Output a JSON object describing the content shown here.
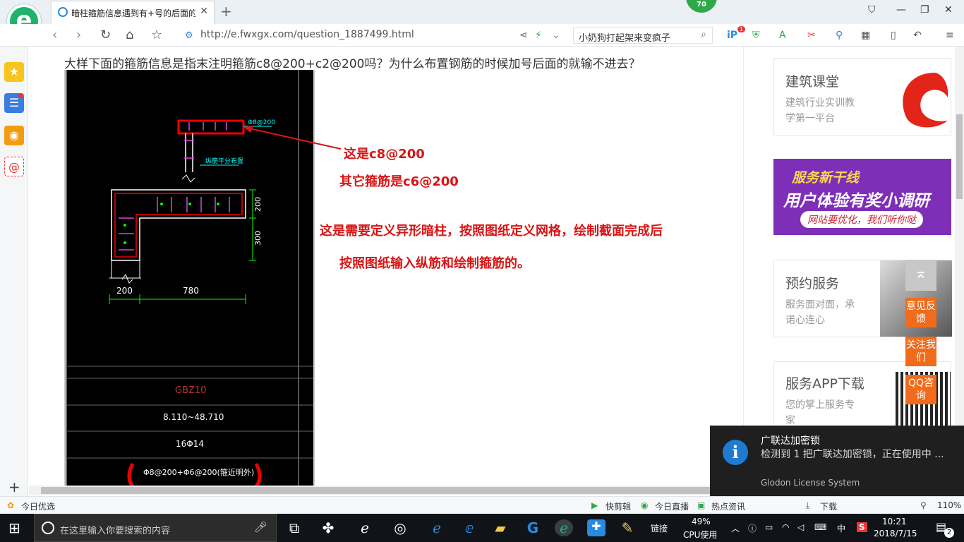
{
  "browser": {
    "tab_title": "暗柱箍筋信息遇到有+号的后面的",
    "badge": "70",
    "url": "http://e.fwxgx.com/question_1887499.html",
    "search_text": "小奶狗打起架来变疯子",
    "badge_count": "1"
  },
  "question": {
    "text": "大样下面的箍筋信息是指末注明箍筋c8@200+c2@200吗？为什么布置钢筋的时候加号后面的就输不进去？"
  },
  "drawing": {
    "top_label": "Φ8@200",
    "mid_label": "纵筋平分布置",
    "dim_200v": "200",
    "dim_300v": "300",
    "dim_200h": "200",
    "dim_780h": "780",
    "row1": "GBZ10",
    "row2": "8.110~48.710",
    "row3": "16Φ14",
    "row4": "Φ8@200+Φ6@200(箍近明外)"
  },
  "answer": {
    "line1": "这是c8@200",
    "line2": "其它箍筋是c6@200",
    "line3": "这是需要定义异形暗柱，按照图纸定义网格，绘制截面完成后",
    "line4": "按照图纸输入纵筋和绘制箍筋的。"
  },
  "sidebar_right": {
    "card1_title": "建筑课堂",
    "card1_desc1": "建筑行业实训教",
    "card1_desc2": "学第一平台",
    "banner_line1": "服务新干线",
    "banner_line2": "用户体验有奖小调研",
    "banner_line3": "网站要优化，我们听你哒",
    "card2_title": "预约服务",
    "card2_desc1": "服务面对面，承",
    "card2_desc2": "诺心连心",
    "card3_title": "服务APP下载",
    "card3_desc1": "您的掌上服务专",
    "card3_desc2": "家"
  },
  "float_buttons": {
    "feedback": "意见反馈",
    "follow": "关注我们",
    "qq": "QQ咨询"
  },
  "statusbar": {
    "left": "今日优选",
    "kuaijianji": "快剪辑",
    "live": "今日直播",
    "news": "热点资讯",
    "download": "下载",
    "zoom": "110%"
  },
  "toast": {
    "title": "广联达加密锁",
    "body": "检测到 1 把广联达加密锁，正在使用中 ...",
    "footer": "Glodon License System"
  },
  "taskbar": {
    "search_placeholder": "在这里输入你要搜索的内容",
    "links": "链接",
    "cpu_pct": "49%",
    "cpu_label": "CPU使用",
    "ime": "中",
    "time": "10:21",
    "date": "2018/7/15",
    "notif_count": "2"
  },
  "colors": {
    "accent_green": "#1fb36b",
    "answer_red": "#d91414",
    "cad_black": "#000000"
  }
}
